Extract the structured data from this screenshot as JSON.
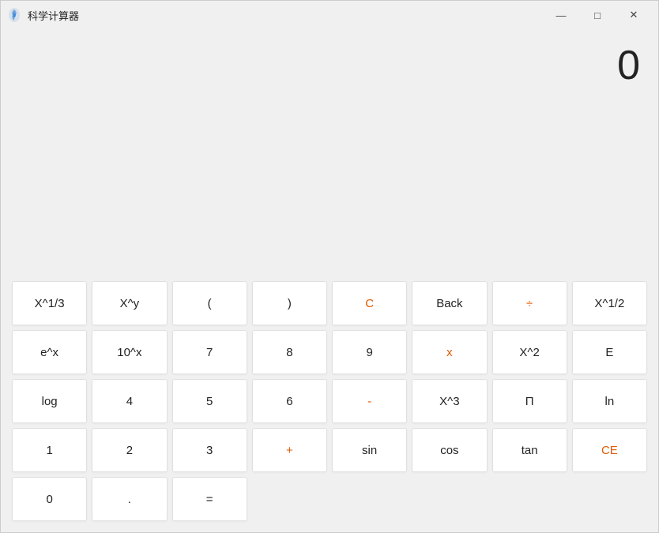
{
  "titleBar": {
    "title": "科学计算器",
    "minimize": "—",
    "maximize": "□",
    "close": "✕"
  },
  "display": {
    "value": "0"
  },
  "buttons": [
    {
      "label": "X^1/3",
      "color": "normal",
      "row": 1,
      "col": 1
    },
    {
      "label": "X^y",
      "color": "normal",
      "row": 1,
      "col": 2
    },
    {
      "label": "(",
      "color": "normal",
      "row": 1,
      "col": 3
    },
    {
      "label": ")",
      "color": "normal",
      "row": 1,
      "col": 4
    },
    {
      "label": "C",
      "color": "red",
      "row": 1,
      "col": 5
    },
    {
      "label": "Back",
      "color": "normal",
      "row": 1,
      "col": 6
    },
    {
      "label": "÷",
      "color": "red",
      "row": 1,
      "col": 7
    },
    {
      "label": "X^1/2",
      "color": "normal",
      "row": 2,
      "col": 1
    },
    {
      "label": "e^x",
      "color": "normal",
      "row": 2,
      "col": 2
    },
    {
      "label": "10^x",
      "color": "normal",
      "row": 2,
      "col": 3
    },
    {
      "label": "7",
      "color": "normal",
      "row": 2,
      "col": 4
    },
    {
      "label": "8",
      "color": "normal",
      "row": 2,
      "col": 5
    },
    {
      "label": "9",
      "color": "normal",
      "row": 2,
      "col": 6
    },
    {
      "label": "x",
      "color": "red",
      "row": 2,
      "col": 7
    },
    {
      "label": "X^2",
      "color": "normal",
      "row": 3,
      "col": 1
    },
    {
      "label": "E",
      "color": "normal",
      "row": 3,
      "col": 2
    },
    {
      "label": "log",
      "color": "normal",
      "row": 3,
      "col": 3
    },
    {
      "label": "4",
      "color": "normal",
      "row": 3,
      "col": 4
    },
    {
      "label": "5",
      "color": "normal",
      "row": 3,
      "col": 5
    },
    {
      "label": "6",
      "color": "normal",
      "row": 3,
      "col": 6
    },
    {
      "label": "-",
      "color": "red",
      "row": 3,
      "col": 7
    },
    {
      "label": "X^3",
      "color": "normal",
      "row": 4,
      "col": 1
    },
    {
      "label": "Π",
      "color": "normal",
      "row": 4,
      "col": 2
    },
    {
      "label": "ln",
      "color": "normal",
      "row": 4,
      "col": 3
    },
    {
      "label": "1",
      "color": "normal",
      "row": 4,
      "col": 4
    },
    {
      "label": "2",
      "color": "normal",
      "row": 4,
      "col": 5
    },
    {
      "label": "3",
      "color": "normal",
      "row": 4,
      "col": 6
    },
    {
      "label": "+",
      "color": "red",
      "row": 4,
      "col": 7
    },
    {
      "label": "sin",
      "color": "normal",
      "row": 5,
      "col": 1
    },
    {
      "label": "cos",
      "color": "normal",
      "row": 5,
      "col": 2
    },
    {
      "label": "tan",
      "color": "normal",
      "row": 5,
      "col": 3
    },
    {
      "label": "CE",
      "color": "red",
      "row": 5,
      "col": 4
    },
    {
      "label": "0",
      "color": "normal",
      "row": 5,
      "col": 5
    },
    {
      "label": ".",
      "color": "normal",
      "row": 5,
      "col": 6
    },
    {
      "label": "=",
      "color": "normal",
      "row": 5,
      "col": 7
    }
  ]
}
